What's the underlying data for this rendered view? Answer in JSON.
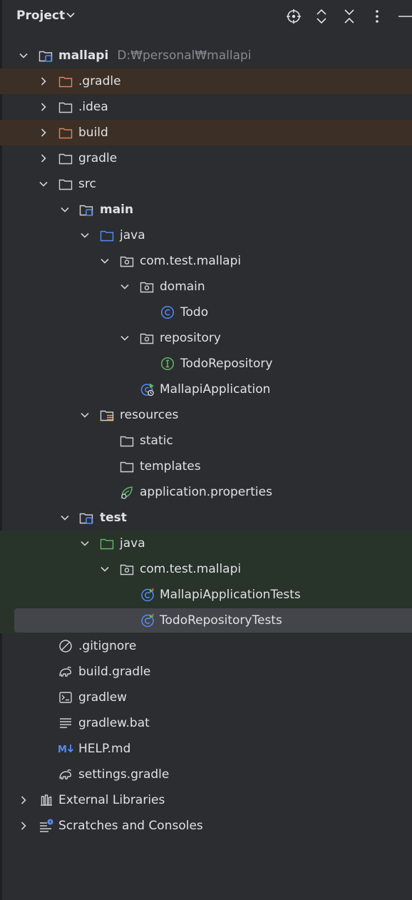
{
  "header": {
    "title": "Project",
    "icons": [
      "locate-icon",
      "expand-collapse-icon",
      "collapse-all-icon",
      "more-options-icon",
      "hide-icon"
    ]
  },
  "tree": {
    "root_label": "mallapi",
    "root_path": "D:₩personal₩mallapi",
    "gradle_hidden": ".gradle",
    "idea": ".idea",
    "build": "build",
    "gradle": "gradle",
    "src": "src",
    "main": "main",
    "main_java": "java",
    "main_pkg": "com.test.mallapi",
    "domain": "domain",
    "todo": "Todo",
    "repository": "repository",
    "todo_repository": "TodoRepository",
    "mallapi_application": "MallapiApplication",
    "resources": "resources",
    "static": "static",
    "templates": "templates",
    "application_properties": "application.properties",
    "test": "test",
    "test_java": "java",
    "test_pkg": "com.test.mallapi",
    "mallapi_application_tests": "MallapiApplicationTests",
    "todo_repository_tests": "TodoRepositoryTests",
    "gitignore": ".gitignore",
    "build_gradle": "build.gradle",
    "gradlew": "gradlew",
    "gradlew_bat": "gradlew.bat",
    "help_md": "HELP.md",
    "settings_gradle": "settings.gradle",
    "external_libraries": "External Libraries",
    "scratches": "Scratches and Consoles"
  },
  "colors": {
    "background": "#2b2d30",
    "excluded_row": "#3c2f25",
    "test_row": "#283329",
    "selection": "#43454a",
    "folder_blue": "#548af7",
    "folder_orange": "#d9845b",
    "folder_green": "#5fb865",
    "text": "#dfe1e5",
    "path_text": "#868a91"
  }
}
